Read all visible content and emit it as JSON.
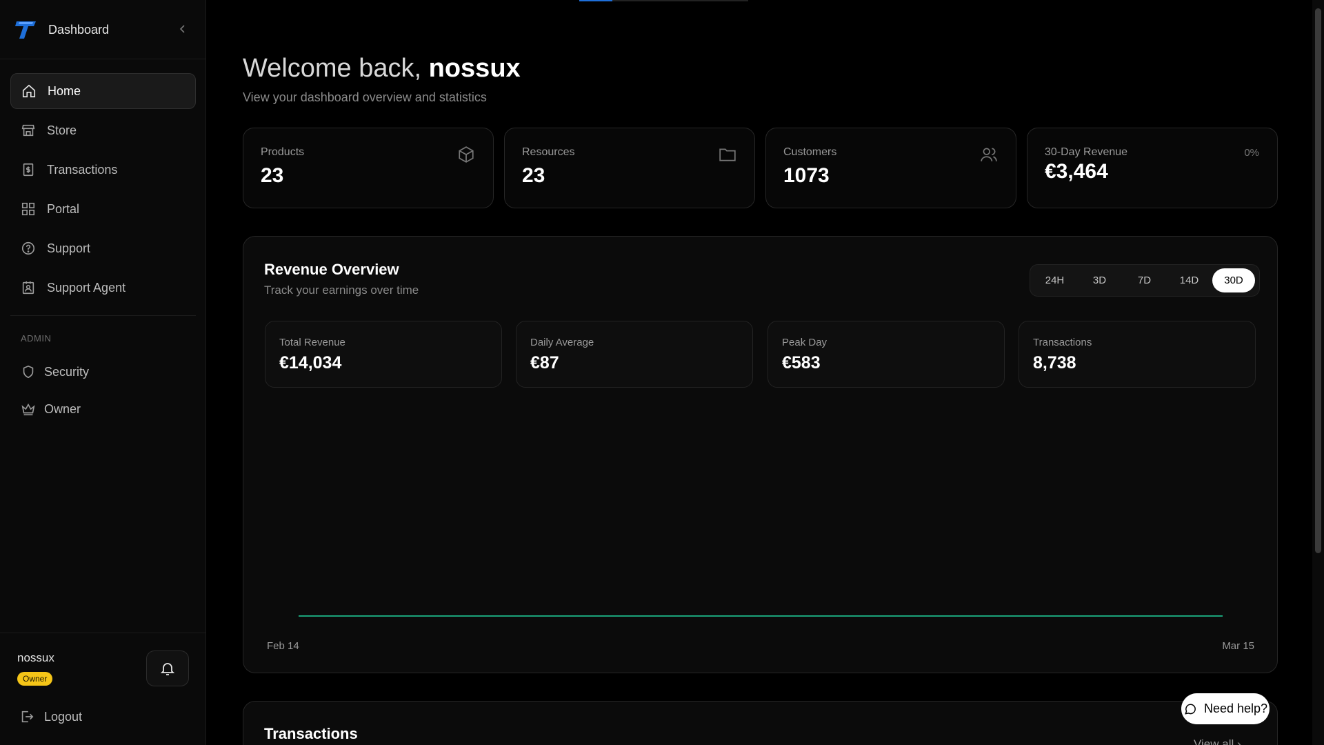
{
  "sidebar": {
    "brand_title": "Dashboard",
    "nav": [
      {
        "label": "Home",
        "icon": "home-icon",
        "active": true
      },
      {
        "label": "Store",
        "icon": "store-icon"
      },
      {
        "label": "Transactions",
        "icon": "receipt-icon"
      },
      {
        "label": "Portal",
        "icon": "grid-icon"
      },
      {
        "label": "Support",
        "icon": "help-circle-icon"
      },
      {
        "label": "Support Agent",
        "icon": "badge-icon"
      }
    ],
    "admin_label": "ADMIN",
    "admin_nav": [
      {
        "label": "Security",
        "icon": "shield-icon"
      },
      {
        "label": "Owner",
        "icon": "crown-icon"
      }
    ],
    "user": {
      "name": "nossux",
      "role": "Owner"
    },
    "logout_label": "Logout"
  },
  "header": {
    "welcome_prefix": "Welcome back,",
    "username": "nossux",
    "subtitle": "View your dashboard overview and statistics"
  },
  "stats": [
    {
      "label": "Products",
      "value": "23",
      "icon": "box-icon"
    },
    {
      "label": "Resources",
      "value": "23",
      "icon": "folder-icon"
    },
    {
      "label": "Customers",
      "value": "1073",
      "icon": "users-icon"
    },
    {
      "label": "30-Day Revenue",
      "value": "€3,464",
      "change": "0%"
    }
  ],
  "revenue": {
    "title": "Revenue Overview",
    "subtitle": "Track your earnings over time",
    "ranges": [
      "24H",
      "3D",
      "7D",
      "14D",
      "30D"
    ],
    "active_range": "30D",
    "metrics": [
      {
        "label": "Total Revenue",
        "value": "€14,034"
      },
      {
        "label": "Daily Average",
        "value": "€87"
      },
      {
        "label": "Peak Day",
        "value": "€583"
      },
      {
        "label": "Transactions",
        "value": "8,738"
      }
    ]
  },
  "chart_data": {
    "type": "line",
    "x_start_label": "Feb 14",
    "x_end_label": "Mar 15",
    "line_color": "#1aa37a",
    "series": [
      {
        "values": [
          0,
          0,
          0,
          0,
          0,
          0,
          0,
          0,
          0,
          0,
          0,
          0,
          0,
          0,
          0,
          0,
          0,
          0,
          0,
          0,
          0,
          0,
          0,
          0,
          0,
          0,
          0,
          0,
          0,
          0,
          0
        ]
      }
    ],
    "grid": false
  },
  "transactions": {
    "title": "Transactions",
    "view_all": "View all"
  },
  "help": {
    "label": "Need help?"
  },
  "colors": {
    "accent": "#1e6fd9",
    "badge": "#f5c518",
    "chart_line": "#1aa37a"
  }
}
